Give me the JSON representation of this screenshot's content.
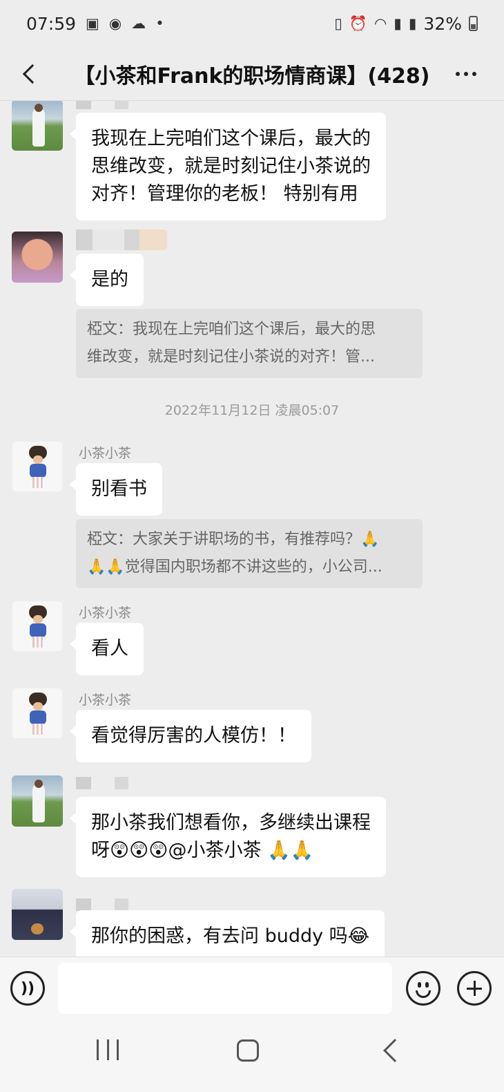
{
  "status_bar": {
    "time": "07:59",
    "battery": "32%",
    "icons": [
      "gallery-icon",
      "weibo-icon",
      "cloud-icon",
      "dot-icon",
      "nfc-icon",
      "alarm-icon",
      "wifi-icon",
      "signal-icon",
      "signal-icon",
      "battery-icon"
    ]
  },
  "header": {
    "title": "【小茶和Frank的职场情商课】(428)"
  },
  "messages": [
    {
      "text_lines": [
        "我现在上完咱们这个课后，最大的",
        "思维改变，就是时刻记住小茶说的",
        "对齐！管理你的老板！ 特别有用"
      ]
    },
    {
      "text": "是的",
      "quote_lines": [
        "椏文：我现在上完咱们这个课后，最大的思",
        "维改变，就是时刻记住小茶说的对齐！管..."
      ]
    },
    {
      "timestamp": "2022年11月12日 凌晨05:07"
    },
    {
      "sender": "小茶小茶",
      "text": "别看书",
      "quote_lines": [
        "椏文：大家关于讲职场的书，有推荐吗？🙏",
        "🙏🙏觉得国内职场都不讲这些的，小公司..."
      ]
    },
    {
      "sender": "小茶小茶",
      "text": "看人"
    },
    {
      "sender": "小茶小茶",
      "text": "看觉得厉害的人模仿！！"
    },
    {
      "text_lines": [
        "那小茶我们想看你，多继续出课程",
        "呀😲😲😲@小茶小茶  🙏🙏"
      ]
    },
    {
      "text": "那你的困惑，有去问 buddy 吗😂"
    }
  ],
  "input_bar": {
    "placeholder": ""
  },
  "colors": {
    "background": "#ededed",
    "bubble": "#ffffff",
    "quote": "#e1e1e1"
  }
}
